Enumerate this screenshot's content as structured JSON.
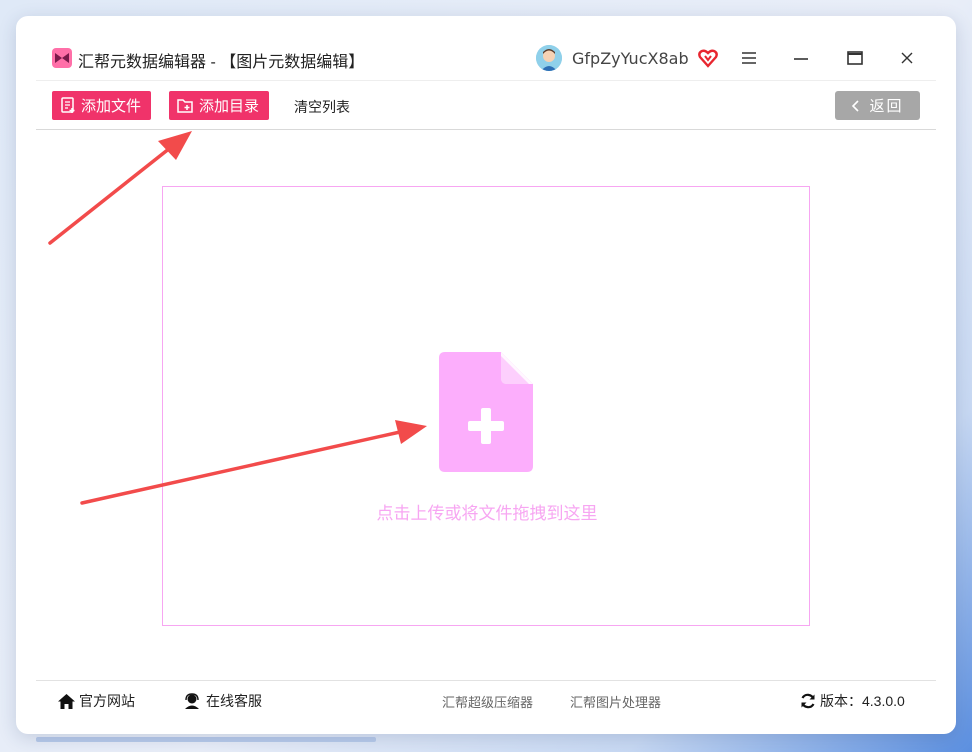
{
  "window": {
    "title": "汇帮元数据编辑器 - 【图片元数据编辑】",
    "user_name": "GfpZyYucX8ab"
  },
  "toolbar": {
    "add_file_label": "添加文件",
    "add_dir_label": "添加目录",
    "clear_list_label": "清空列表",
    "back_label": "返回"
  },
  "dropzone": {
    "hint": "点击上传或将文件拖拽到这里"
  },
  "statusbar": {
    "website_label": "官方网站",
    "support_label": "在线客服",
    "link_compressor": "汇帮超级压缩器",
    "link_image_tool": "汇帮图片处理器",
    "version_label": "版本：4.3.0.0"
  },
  "colors": {
    "accent": "#f0336a",
    "drop_accent": "#f7a6f2",
    "arrow": "#f24b4b"
  }
}
